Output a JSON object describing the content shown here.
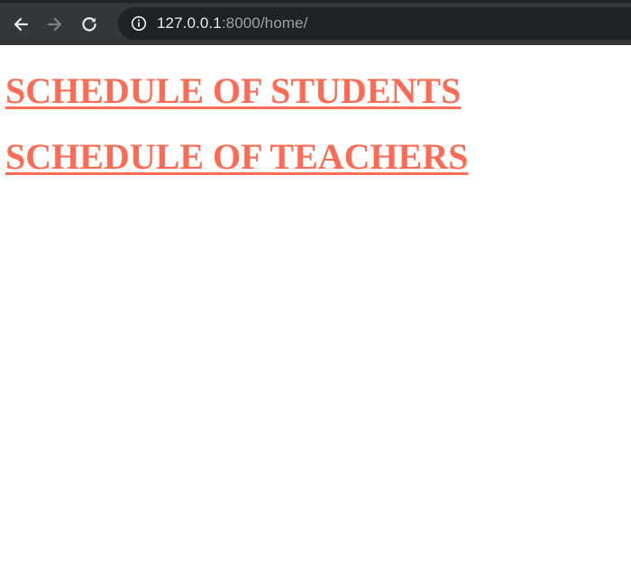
{
  "browser": {
    "url_host": "127.0.0.1",
    "url_rest": ":8000/home/",
    "colors": {
      "toolbar": "#35363a",
      "omnibox": "#202124",
      "url_host": "#e8eaed",
      "url_rest": "#9aa0a6"
    },
    "icons": [
      "back-arrow-icon",
      "forward-arrow-icon",
      "reload-icon",
      "info-icon"
    ]
  },
  "page": {
    "links": [
      {
        "label": "SCHEDULE OF STUDENTS"
      },
      {
        "label": "SCHEDULE OF TEACHERS"
      }
    ],
    "link_color": "#fd6b55"
  }
}
